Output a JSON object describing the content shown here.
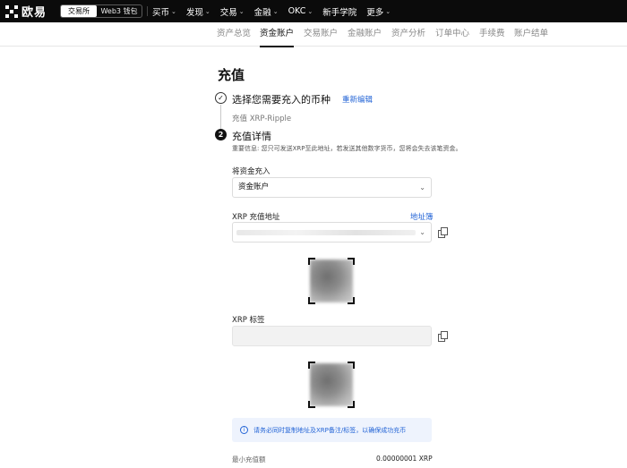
{
  "topbar": {
    "logo_text": "欧易",
    "switch": {
      "exchange": "交易所",
      "wallet": "Web3 钱包"
    },
    "nav": [
      {
        "label": "买币",
        "has_dropdown": true
      },
      {
        "label": "发现",
        "has_dropdown": true
      },
      {
        "label": "交易",
        "has_dropdown": true
      },
      {
        "label": "金融",
        "has_dropdown": true
      },
      {
        "label": "OKC",
        "has_dropdown": true
      },
      {
        "label": "新手学院",
        "has_dropdown": false
      },
      {
        "label": "更多",
        "has_dropdown": true
      }
    ]
  },
  "subnav": {
    "items": [
      "资产总览",
      "资金账户",
      "交易账户",
      "金融账户",
      "资产分析",
      "订单中心",
      "手续费",
      "账户结单"
    ],
    "active_index": 1
  },
  "page": {
    "title": "充值",
    "step1": {
      "icon": "check-icon",
      "title": "选择您需要充入的币种",
      "edit_label": "重新编辑",
      "value": "充值 XRP-Ripple"
    },
    "step2": {
      "number": "2",
      "title": "充值详情",
      "notice": "重要信息: 您只可发送XRP至此地址，若发送其他数字货币，您将会失去该笔资金。"
    },
    "deposit_to": {
      "label": "将资金充入",
      "value": "资金账户"
    },
    "address": {
      "label": "XRP 充值地址",
      "address_book": "地址簿"
    },
    "tag": {
      "label": "XRP 标签"
    },
    "tip": "请务必同时复制地址及XRP备注/标签，以确保成功充币",
    "min_deposit": {
      "label": "最小充值额",
      "value": "0.00000001 XRP"
    }
  },
  "colors": {
    "topbar_bg": "#0b0b0b",
    "link": "#2364d6",
    "tip_bg": "#eef3fd"
  }
}
